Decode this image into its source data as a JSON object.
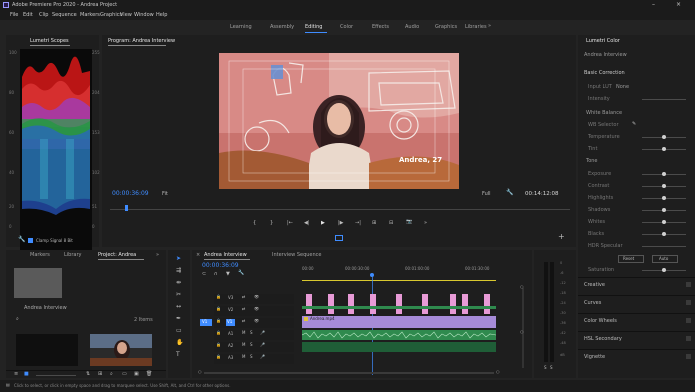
{
  "titlebar": {
    "title": "Adobe Premiere Pro 2020 - Andrea Project",
    "minimize": "–",
    "close": "×"
  },
  "menu": [
    "File",
    "Edit",
    "Clip",
    "Sequence",
    "Markers",
    "Graphics",
    "View",
    "Window",
    "Help"
  ],
  "workspaces": [
    "Learning",
    "Assembly",
    "Editing",
    "Color",
    "Effects",
    "Audio",
    "Graphics",
    "Libraries"
  ],
  "workspace_more": "»",
  "scopes": {
    "tab": "Lumetri Scopes",
    "labels_left": [
      "100",
      "80",
      "60",
      "40",
      "20",
      "0"
    ],
    "labels_right": [
      "255",
      "204",
      "153",
      "102",
      "51",
      "0"
    ],
    "footer": "Clamp Signal  8 Bit"
  },
  "program": {
    "tab": "Program: Andrea Interview",
    "lower_third": "Andrea, 27",
    "timecode_left": "00:00:36:09",
    "fit": "Fit",
    "quality": "Full",
    "timecode_right": "00:14:12:08",
    "transport": [
      "{",
      "}",
      "|←",
      "◀|",
      "▶",
      "|▶",
      "→|",
      "⊞",
      "⊟",
      "📷",
      "»"
    ],
    "add": "+"
  },
  "lumetri": {
    "tab": "Lumetri Color",
    "header": "Andrea Interview",
    "sections": [
      "Basic Correction",
      "Input LUT",
      "Intensity",
      "White Balance",
      "WB Selector",
      "Temperature",
      "Tint",
      "Tone",
      "Exposure",
      "Contrast",
      "Highlights",
      "Shadows",
      "Whites",
      "Blacks",
      "HDR Specular",
      "Saturation",
      "Creative",
      "Curves",
      "Color Wheels",
      "HSL Secondary",
      "Vignette"
    ],
    "input_lut_value": "None",
    "reset": "Reset",
    "auto": "Auto"
  },
  "project": {
    "tabs": [
      "Markers",
      "Library",
      "Project: Andrea"
    ],
    "item_name": "Andrea Interview",
    "search_placeholder": "",
    "count": "2 Items",
    "more": "»"
  },
  "timeline": {
    "tab": "Andrea Interview",
    "tab2": "Interview Sequence",
    "timecode": "00:00:36:09",
    "ruler": [
      "00:00",
      "00:00:30:00",
      "00:01:00:00",
      "00:01:30:00"
    ],
    "video_tracks": [
      "V3",
      "V2",
      "V1"
    ],
    "audio_tracks": [
      "A1",
      "A2",
      "A3"
    ],
    "source_patch": "V1",
    "clip_label": "Andrea.mp4",
    "meter_scale": [
      "0",
      "-6",
      "-12",
      "-18",
      "-24",
      "-30",
      "-36",
      "-42",
      "-48",
      "dB"
    ]
  },
  "status": "Click to select, or click in empty space and drag to marquee select. Use Shift, Alt, and Ctrl for other options.",
  "colors": {
    "accent": "#3f8cff",
    "purple_clip": "#a68bd8",
    "pink_clip": "#e79ad6",
    "green_clip": "#2f8a4e",
    "playhead": "#3f8cff"
  }
}
